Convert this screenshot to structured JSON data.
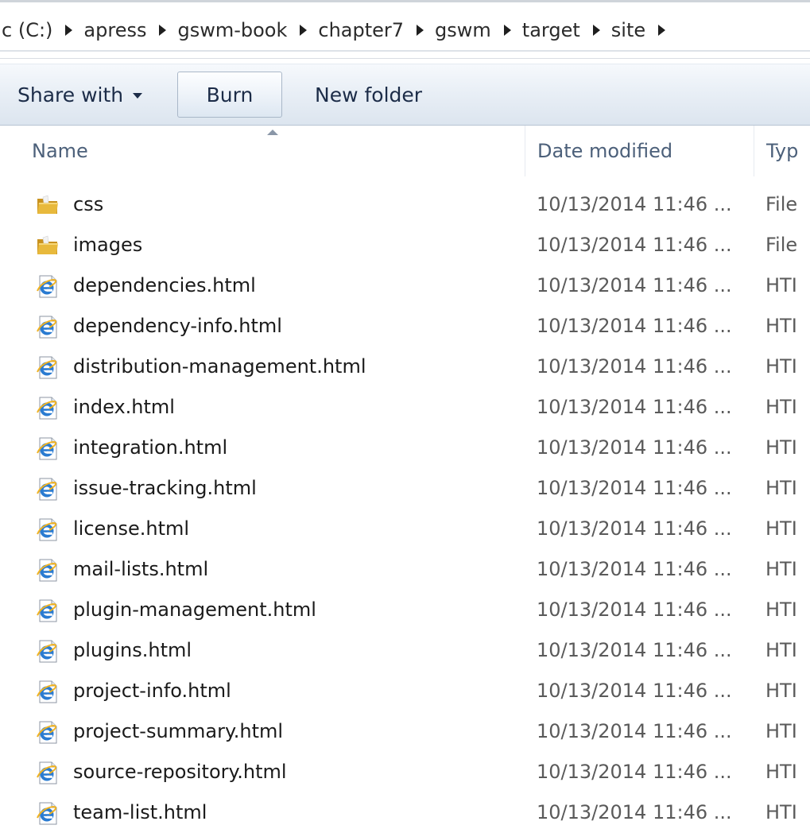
{
  "breadcrumb": {
    "items": [
      "c (C:)",
      "apress",
      "gswm-book",
      "chapter7",
      "gswm",
      "target",
      "site"
    ]
  },
  "toolbar": {
    "share_label": "Share with",
    "burn_label": "Burn",
    "new_folder_label": "New folder"
  },
  "columns": {
    "name": "Name",
    "date": "Date modified",
    "type": "Typ"
  },
  "colors": {
    "folder": "#e8b93c",
    "ie_blue": "#2a7bd1"
  },
  "files": [
    {
      "icon": "folder-icon",
      "name": "css",
      "date": "10/13/2014 11:46 ...",
      "type": "File"
    },
    {
      "icon": "folder-icon",
      "name": "images",
      "date": "10/13/2014 11:46 ...",
      "type": "File"
    },
    {
      "icon": "ie-html-icon",
      "name": "dependencies.html",
      "date": "10/13/2014 11:46 ...",
      "type": "HTI"
    },
    {
      "icon": "ie-html-icon",
      "name": "dependency-info.html",
      "date": "10/13/2014 11:46 ...",
      "type": "HTI"
    },
    {
      "icon": "ie-html-icon",
      "name": "distribution-management.html",
      "date": "10/13/2014 11:46 ...",
      "type": "HTI"
    },
    {
      "icon": "ie-html-icon",
      "name": "index.html",
      "date": "10/13/2014 11:46 ...",
      "type": "HTI"
    },
    {
      "icon": "ie-html-icon",
      "name": "integration.html",
      "date": "10/13/2014 11:46 ...",
      "type": "HTI"
    },
    {
      "icon": "ie-html-icon",
      "name": "issue-tracking.html",
      "date": "10/13/2014 11:46 ...",
      "type": "HTI"
    },
    {
      "icon": "ie-html-icon",
      "name": "license.html",
      "date": "10/13/2014 11:46 ...",
      "type": "HTI"
    },
    {
      "icon": "ie-html-icon",
      "name": "mail-lists.html",
      "date": "10/13/2014 11:46 ...",
      "type": "HTI"
    },
    {
      "icon": "ie-html-icon",
      "name": "plugin-management.html",
      "date": "10/13/2014 11:46 ...",
      "type": "HTI"
    },
    {
      "icon": "ie-html-icon",
      "name": "plugins.html",
      "date": "10/13/2014 11:46 ...",
      "type": "HTI"
    },
    {
      "icon": "ie-html-icon",
      "name": "project-info.html",
      "date": "10/13/2014 11:46 ...",
      "type": "HTI"
    },
    {
      "icon": "ie-html-icon",
      "name": "project-summary.html",
      "date": "10/13/2014 11:46 ...",
      "type": "HTI"
    },
    {
      "icon": "ie-html-icon",
      "name": "source-repository.html",
      "date": "10/13/2014 11:46 ...",
      "type": "HTI"
    },
    {
      "icon": "ie-html-icon",
      "name": "team-list.html",
      "date": "10/13/2014 11:46 ...",
      "type": "HTI"
    }
  ]
}
